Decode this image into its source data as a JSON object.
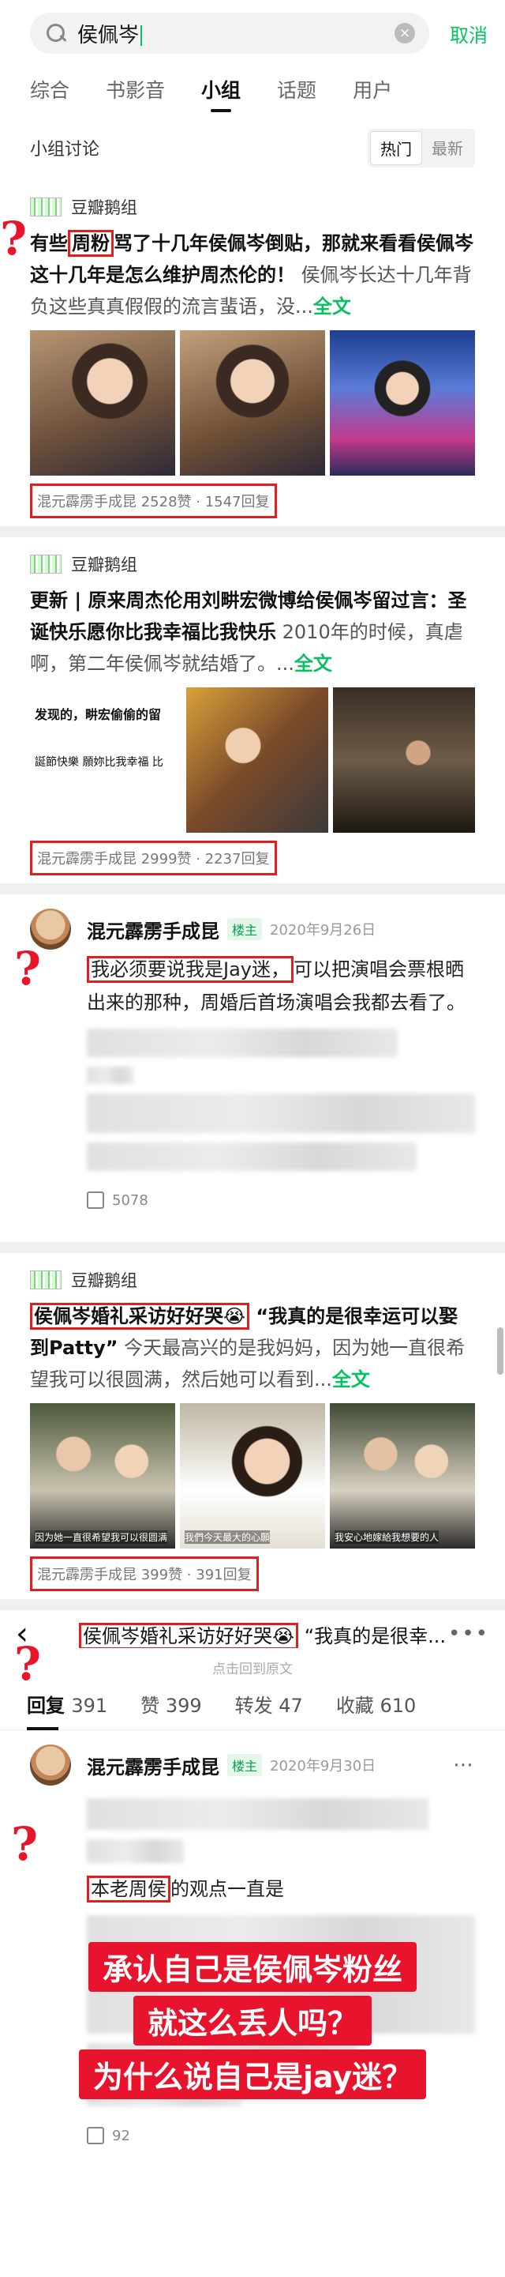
{
  "search": {
    "value": "侯佩岑",
    "cancel_label": "取消"
  },
  "tabs": [
    "综合",
    "书影音",
    "小组",
    "话题",
    "用户"
  ],
  "active_tab": "小组",
  "section": {
    "title": "小组讨论",
    "sort_hot": "热门",
    "sort_new": "最新"
  },
  "posts": [
    {
      "group": "豆瓣鹅组",
      "title_a": "有些",
      "title_hl": "周粉",
      "title_b": "骂了十几年侯佩岑倒贴，那就来看看侯佩岑这十几年是怎么维护周杰伦的！",
      "rest": "侯佩岑长达十几年背负这些真真假假的流言蜚语，没...",
      "more": "全文",
      "meta": "混元霹雳手成昆 2528赞 · 1547回复"
    },
    {
      "group": "豆瓣鹅组",
      "title_a": "更新 | 原来周杰伦用刘畊宏微博给侯佩岑留过言：圣诞快乐愿你比我幸福比我快乐",
      "rest": "2010年的时候，真虐啊，第二年侯佩岑就结婚了。...",
      "more": "全文",
      "image_text_1": "发现的，畊宏偷偷的留",
      "image_text_2": "誕節快樂 願妳比我幸福 比",
      "meta": "混元霹雳手成昆 2999赞 · 2237回复"
    },
    {
      "group": "豆瓣鹅组",
      "title_hl": "侯佩岑婚礼采访好好哭😭",
      "title_b": "“我真的是很幸运可以娶到Patty”",
      "rest": "今天最高兴的是我妈妈，因为她一直很希望我可以很圆满，然后她可以看到...",
      "more": "全文",
      "image_text_1": "因为她一直很希望我可以很圆满",
      "image_text_2": "我們今天最大的心願",
      "image_text_3": "我安心地嫁給我想要的人",
      "meta": "混元霹雳手成昆 399赞 · 391回复"
    }
  ],
  "comment1": {
    "author": "混元霹雳手成昆",
    "badge": "楼主",
    "date": "2020年9月26日",
    "hl": "我必须要说我是Jay迷，",
    "text": "可以把演唱会票根晒出来的那种，周婚后首场演唱会我都去看了。",
    "likes": "5078"
  },
  "detail": {
    "title_hl": "侯佩岑婚礼采访好好哭😭",
    "title_rest": "“我真的是很幸...",
    "sub": "点击回到原文",
    "stats": [
      "回复",
      "391",
      "赞",
      "399",
      "转发",
      "47",
      "收藏",
      "610"
    ]
  },
  "comment2": {
    "author": "混元霹雳手成昆",
    "badge": "楼主",
    "date": "2020年9月30日",
    "hl": "本老周侯",
    "text": "的观点一直是",
    "likes": "92"
  },
  "captions": [
    "承认自己是侯佩岑粉丝",
    "就这么丢人吗？",
    "为什么说自己是jay迷？"
  ],
  "colors": {
    "accent": "#07c160",
    "highlight": "#e02020",
    "caption_bg": "#e8132c"
  }
}
